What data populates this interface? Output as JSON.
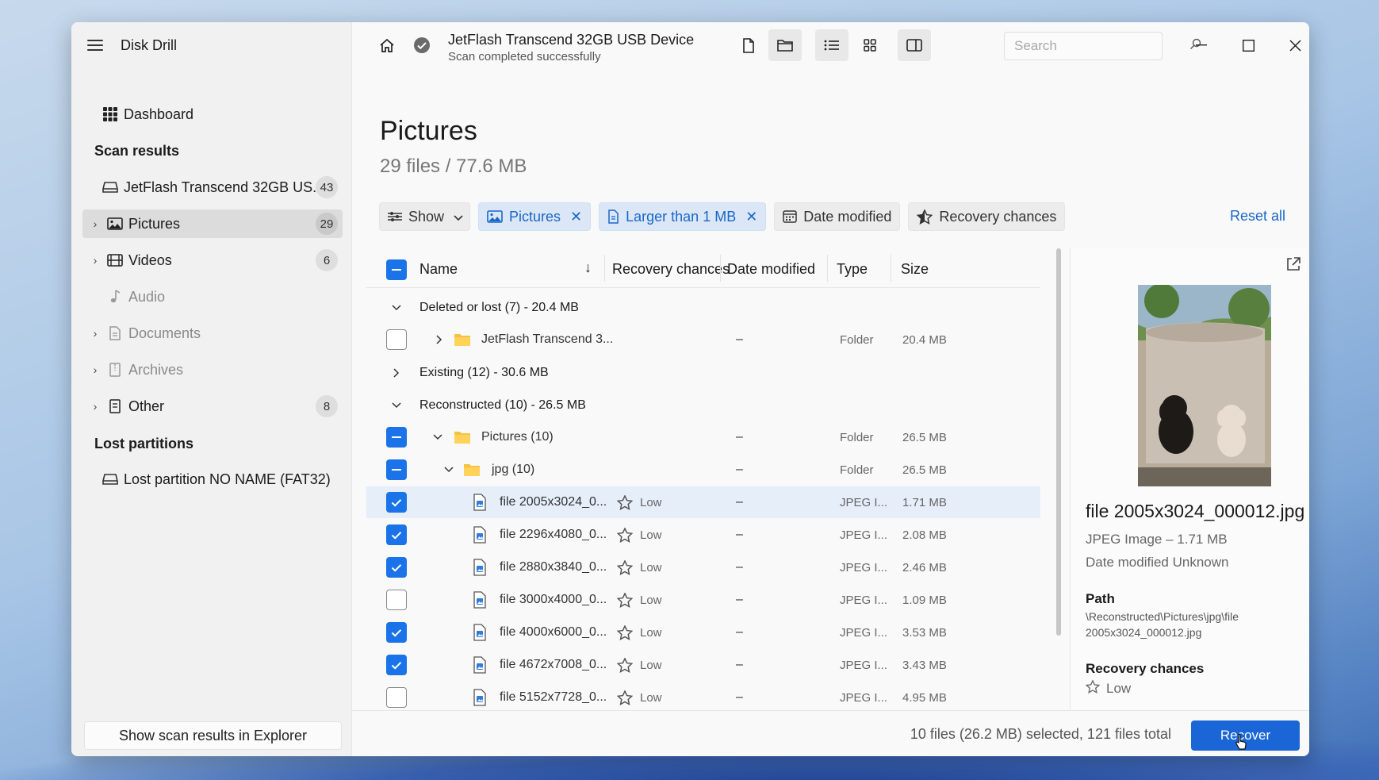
{
  "app": {
    "title": "Disk Drill"
  },
  "sidebar": {
    "dashboard": "Dashboard",
    "scan_results_heading": "Scan results",
    "device": {
      "label": "JetFlash Transcend 32GB US...",
      "count": "43"
    },
    "items": [
      {
        "label": "Pictures",
        "count": "29",
        "icon": "image-icon",
        "active": true
      },
      {
        "label": "Videos",
        "count": "6",
        "icon": "film-icon"
      },
      {
        "label": "Audio",
        "count": "",
        "icon": "music-note-icon",
        "disabled": true
      },
      {
        "label": "Documents",
        "count": "",
        "icon": "document-icon",
        "disabled": true
      },
      {
        "label": "Archives",
        "count": "",
        "icon": "archive-icon",
        "disabled": true
      },
      {
        "label": "Other",
        "count": "8",
        "icon": "other-file-icon"
      }
    ],
    "lost_partitions_heading": "Lost partitions",
    "lost_partition": "Lost partition NO NAME (FAT32)",
    "footer_button": "Show scan results in Explorer"
  },
  "topbar": {
    "device_title": "JetFlash Transcend 32GB USB Device",
    "device_status": "Scan completed successfully",
    "search_placeholder": "Search"
  },
  "page": {
    "title": "Pictures",
    "subtitle": "29 files / 77.6 MB"
  },
  "filters": {
    "show": "Show",
    "pictures": "Pictures",
    "larger": "Larger than 1 MB",
    "date_modified": "Date modified",
    "recovery_chances": "Recovery chances",
    "reset_all": "Reset all"
  },
  "table": {
    "columns": {
      "name": "Name",
      "recovery": "Recovery chances",
      "date": "Date modified",
      "type": "Type",
      "size": "Size"
    },
    "groups": {
      "deleted": "Deleted or lost (7) - 20.4 MB",
      "existing": "Existing (12) - 30.6 MB",
      "reconstructed": "Reconstructed (10) - 26.5 MB"
    },
    "deleted_folder": {
      "name": "JetFlash Transcend 3...",
      "date": "–",
      "type": "Folder",
      "size": "20.4 MB"
    },
    "pictures_folder": {
      "name": "Pictures (10)",
      "date": "–",
      "type": "Folder",
      "size": "26.5 MB"
    },
    "jpg_folder": {
      "name": "jpg (10)",
      "date": "–",
      "type": "Folder",
      "size": "26.5 MB"
    },
    "files": [
      {
        "name": "file 2005x3024_0...",
        "recovery": "Low",
        "date": "–",
        "type": "JPEG I...",
        "size": "1.71 MB",
        "checked": true,
        "selected": true
      },
      {
        "name": "file 2296x4080_0...",
        "recovery": "Low",
        "date": "–",
        "type": "JPEG I...",
        "size": "2.08 MB",
        "checked": true
      },
      {
        "name": "file 2880x3840_0...",
        "recovery": "Low",
        "date": "–",
        "type": "JPEG I...",
        "size": "2.46 MB",
        "checked": true
      },
      {
        "name": "file 3000x4000_0...",
        "recovery": "Low",
        "date": "–",
        "type": "JPEG I...",
        "size": "1.09 MB",
        "checked": false
      },
      {
        "name": "file 4000x6000_0...",
        "recovery": "Low",
        "date": "–",
        "type": "JPEG I...",
        "size": "3.53 MB",
        "checked": true
      },
      {
        "name": "file 4672x7008_0...",
        "recovery": "Low",
        "date": "–",
        "type": "JPEG I...",
        "size": "3.43 MB",
        "checked": true
      },
      {
        "name": "file 5152x7728_0...",
        "recovery": "Low",
        "date": "–",
        "type": "JPEG I...",
        "size": "4.95 MB",
        "checked": false
      }
    ]
  },
  "details": {
    "file_name": "file 2005x3024_000012.jpg",
    "type_size": "JPEG Image – 1.71 MB",
    "date": "Date modified Unknown",
    "path_label": "Path",
    "path_value": "\\Reconstructed\\Pictures\\jpg\\file 2005x3024_000012.jpg",
    "recovery_label": "Recovery chances",
    "recovery_value": "Low"
  },
  "status": {
    "selection": "10 files (26.2 MB) selected, 121 files total",
    "recover_button": "Recover"
  },
  "colors": {
    "accent": "#1a73e8",
    "chip_bg": "#dbe7f7",
    "chip_text": "#1a66c8"
  }
}
